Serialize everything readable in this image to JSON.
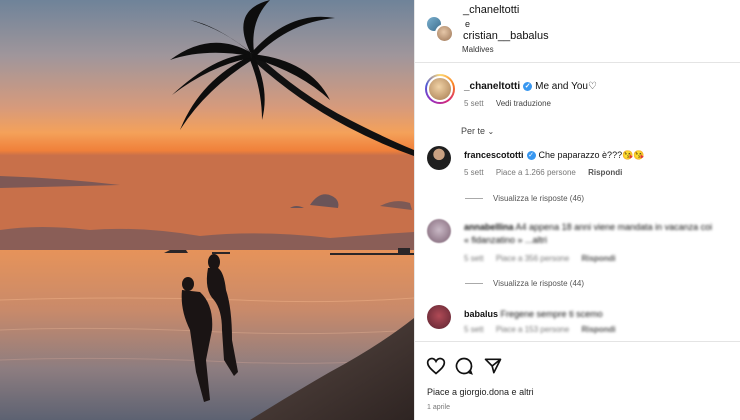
{
  "post": {
    "photo_label": "sunset-beach-photo",
    "header": {
      "user1": "_chaneltotti",
      "conjunction": "e",
      "user2": "cristian__babalus",
      "location": "Maldives"
    },
    "caption": {
      "user": "_chaneltotti",
      "text": "Me and You♡",
      "time": "5 sett",
      "translate": "Vedi traduzione"
    },
    "sort_label": "Per te",
    "comments": [
      {
        "user": "francescototti",
        "text": "Che paparazzo è???😘😘",
        "time": "5 sett",
        "likes": "Piace a 1.266 persone",
        "reply": "Rispondi",
        "view_replies": "Visualizza le risposte (46)"
      },
      {
        "user": "annabellina",
        "text": "A4 appena 18 anni viene mandata in vacanza coi",
        "text2": "« fidanzatino » ...altri",
        "time": "5 sett",
        "likes": "Piace a 356 persone",
        "reply": "Rispondi",
        "view_replies": "Visualizza le risposte (44)"
      },
      {
        "user": "babalus",
        "text": "Fregene sempre ti scemo",
        "time": "5 sett",
        "likes": "Piace a 153 persone",
        "reply": "Rispondi"
      }
    ],
    "footer": {
      "likes_text": "Piace a giorgio.dona e altri",
      "date": "1 aprile"
    }
  },
  "colors": {
    "verified": "#3897f0",
    "sky_top": "#7b8ea3",
    "sunset": "#f08a3c",
    "sea": "#d98a55"
  }
}
